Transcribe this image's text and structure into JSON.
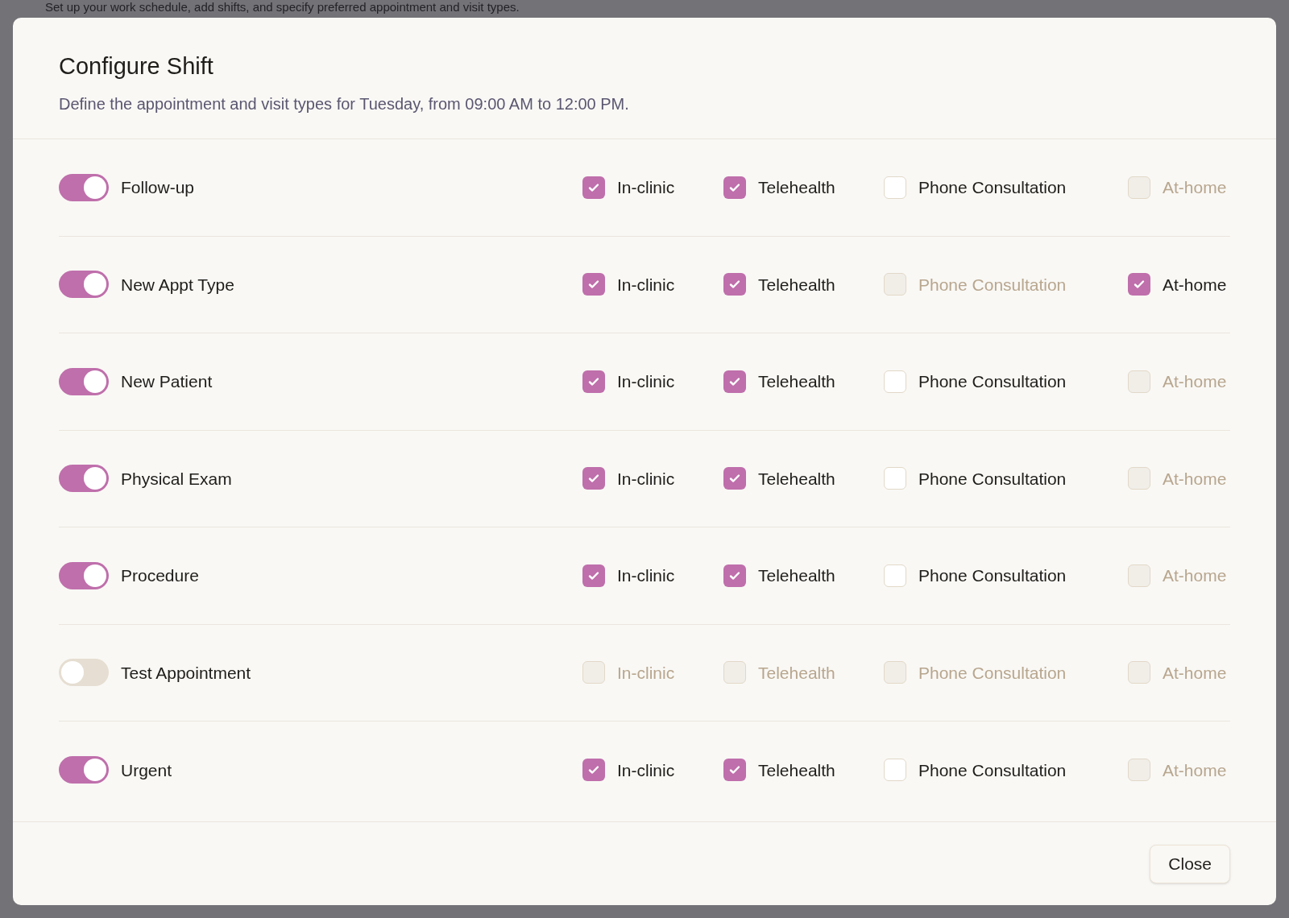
{
  "background_text": "Set up your work schedule, add shifts, and specify preferred appointment and visit types.",
  "dialog": {
    "title": "Configure Shift",
    "description": "Define the appointment and visit types for Tuesday, from 09:00 AM to 12:00 PM.",
    "rows": [
      {
        "name": "Follow-up",
        "on": true,
        "options": [
          {
            "label": "In-clinic",
            "checked": true,
            "disabled": false
          },
          {
            "label": "Telehealth",
            "checked": true,
            "disabled": false
          },
          {
            "label": "Phone Consultation",
            "checked": false,
            "disabled": false
          },
          {
            "label": "At-home",
            "checked": false,
            "disabled": true
          }
        ]
      },
      {
        "name": "New Appt Type",
        "on": true,
        "options": [
          {
            "label": "In-clinic",
            "checked": true,
            "disabled": false
          },
          {
            "label": "Telehealth",
            "checked": true,
            "disabled": false
          },
          {
            "label": "Phone Consultation",
            "checked": false,
            "disabled": true
          },
          {
            "label": "At-home",
            "checked": true,
            "disabled": false
          }
        ]
      },
      {
        "name": "New Patient",
        "on": true,
        "options": [
          {
            "label": "In-clinic",
            "checked": true,
            "disabled": false
          },
          {
            "label": "Telehealth",
            "checked": true,
            "disabled": false
          },
          {
            "label": "Phone Consultation",
            "checked": false,
            "disabled": false
          },
          {
            "label": "At-home",
            "checked": false,
            "disabled": true
          }
        ]
      },
      {
        "name": "Physical Exam",
        "on": true,
        "options": [
          {
            "label": "In-clinic",
            "checked": true,
            "disabled": false
          },
          {
            "label": "Telehealth",
            "checked": true,
            "disabled": false
          },
          {
            "label": "Phone Consultation",
            "checked": false,
            "disabled": false
          },
          {
            "label": "At-home",
            "checked": false,
            "disabled": true
          }
        ]
      },
      {
        "name": "Procedure",
        "on": true,
        "options": [
          {
            "label": "In-clinic",
            "checked": true,
            "disabled": false
          },
          {
            "label": "Telehealth",
            "checked": true,
            "disabled": false
          },
          {
            "label": "Phone Consultation",
            "checked": false,
            "disabled": false
          },
          {
            "label": "At-home",
            "checked": false,
            "disabled": true
          }
        ]
      },
      {
        "name": "Test Appointment",
        "on": false,
        "options": [
          {
            "label": "In-clinic",
            "checked": false,
            "disabled": true
          },
          {
            "label": "Telehealth",
            "checked": false,
            "disabled": true
          },
          {
            "label": "Phone Consultation",
            "checked": false,
            "disabled": true
          },
          {
            "label": "At-home",
            "checked": false,
            "disabled": true
          }
        ]
      },
      {
        "name": "Urgent",
        "on": true,
        "options": [
          {
            "label": "In-clinic",
            "checked": true,
            "disabled": false
          },
          {
            "label": "Telehealth",
            "checked": true,
            "disabled": false
          },
          {
            "label": "Phone Consultation",
            "checked": false,
            "disabled": false
          },
          {
            "label": "At-home",
            "checked": false,
            "disabled": true
          }
        ]
      }
    ],
    "buttons": [
      "Close"
    ]
  }
}
